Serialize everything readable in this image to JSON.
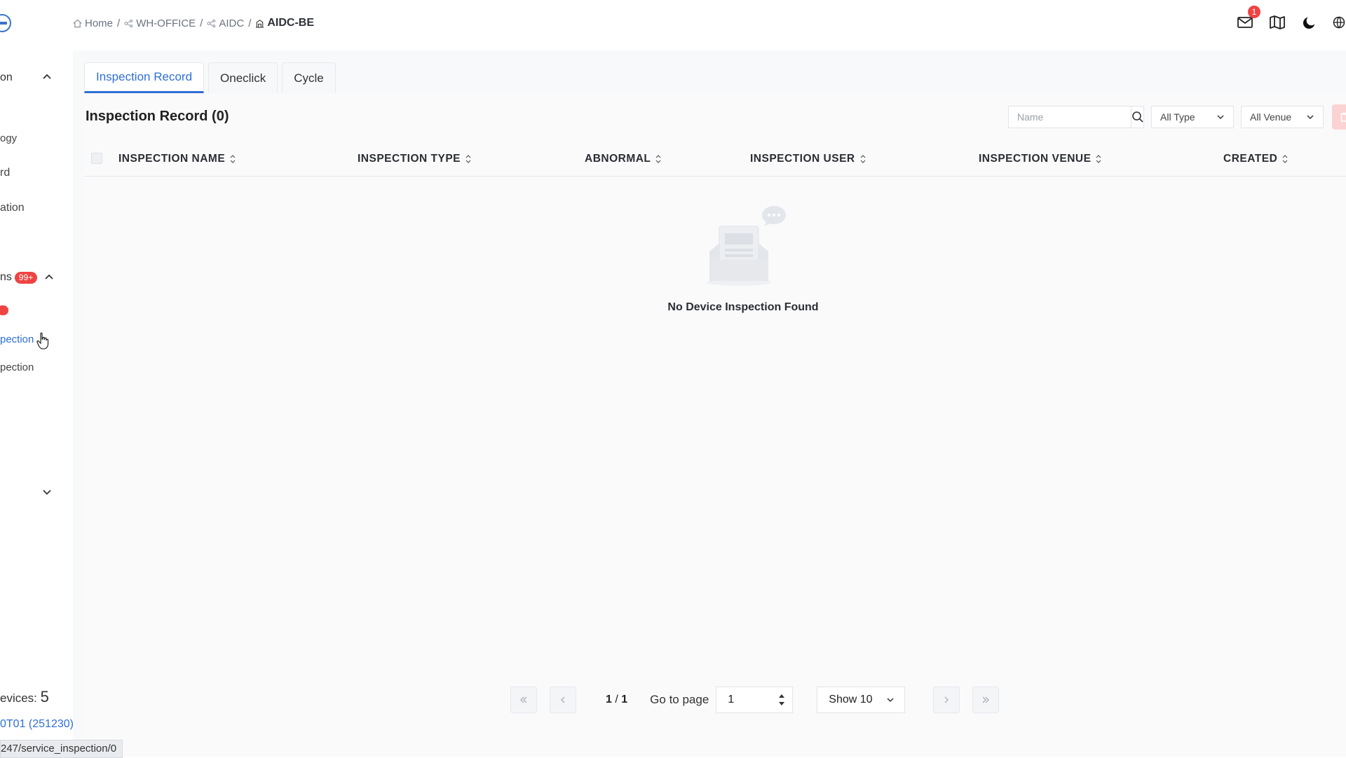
{
  "header": {
    "breadcrumbs": [
      {
        "label": "Home",
        "icon": "home-icon"
      },
      {
        "label": "WH-OFFICE",
        "icon": "network-icon"
      },
      {
        "label": "AIDC",
        "icon": "network-icon"
      },
      {
        "label": "AIDC-BE",
        "icon": "building-icon"
      }
    ],
    "separator": "/",
    "notification_count": "1",
    "actions": [
      "mail-icon",
      "map-icon",
      "moon-icon",
      "globe-icon"
    ]
  },
  "sidebar": {
    "items": [
      {
        "label": "on"
      },
      {
        "label": "ogy"
      },
      {
        "label": "rd"
      },
      {
        "label": "ation"
      },
      {
        "label": "ns",
        "badge": "99+"
      },
      {
        "label": "pection",
        "active": true
      },
      {
        "label": "pection"
      }
    ],
    "devices_label": "evices:",
    "devices_count": "5",
    "device_link": "0T01 (251230)"
  },
  "tabs": [
    {
      "label": "Inspection Record",
      "active": true
    },
    {
      "label": "Oneclick"
    },
    {
      "label": "Cycle"
    }
  ],
  "panel": {
    "title": "Inspection Record (0)",
    "search_placeholder": "Name",
    "type_filter": "All Type",
    "venue_filter": "All Venue"
  },
  "table": {
    "columns": [
      "INSPECTION NAME",
      "INSPECTION TYPE",
      "ABNORMAL",
      "INSPECTION USER",
      "INSPECTION VENUE",
      "CREATED"
    ],
    "rows": [],
    "empty_text": "No Device Inspection Found"
  },
  "pagination": {
    "current": "1",
    "total": "1",
    "separator": "/",
    "go_to_label": "Go to page",
    "go_to_value": "1",
    "page_size": "Show 10"
  },
  "statusbar": {
    "url": "247/service_inspection/0"
  },
  "colors": {
    "accent": "#2f6fd6",
    "danger": "#ef4444",
    "background": "#f8f9fb"
  }
}
